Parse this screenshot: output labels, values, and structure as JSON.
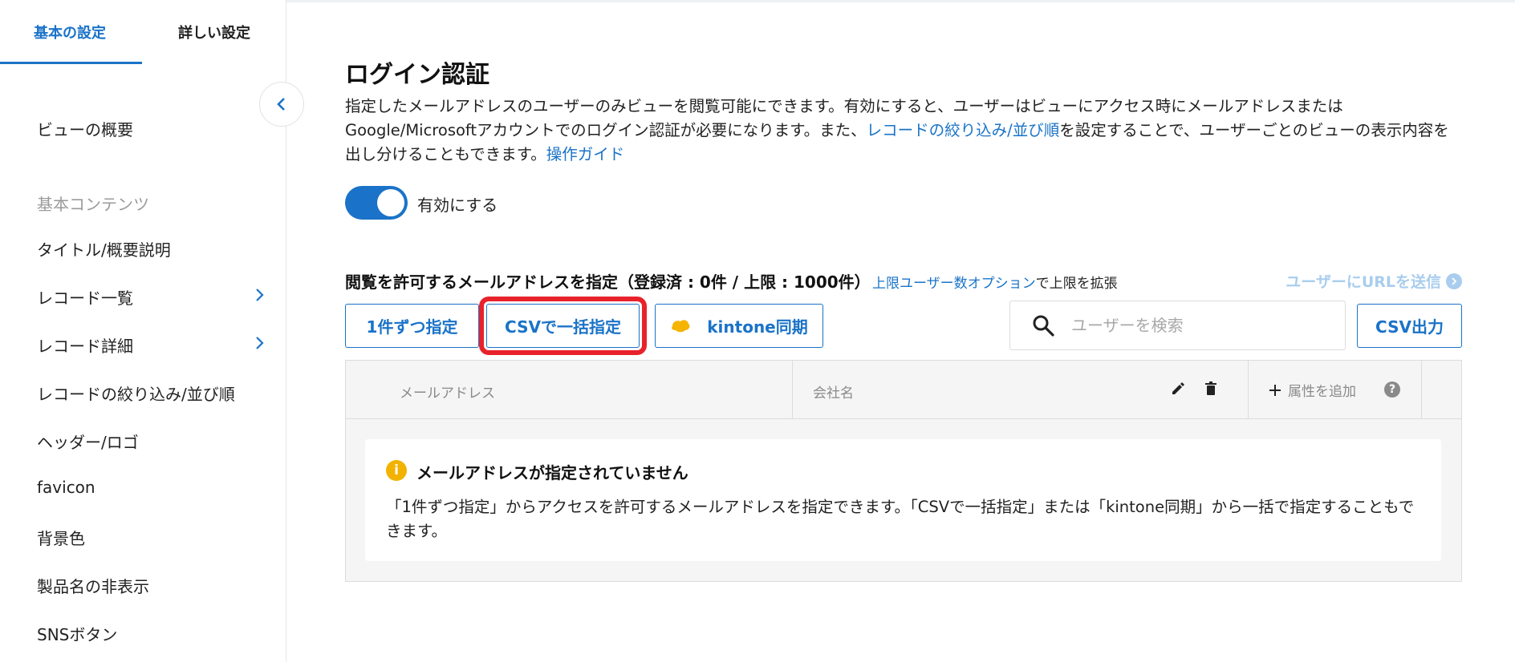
{
  "sidebar": {
    "tabs": [
      {
        "label": "基本の設定",
        "active": true
      },
      {
        "label": "詳しい設定",
        "active": false
      }
    ],
    "items": [
      {
        "label": "ビューの概要"
      },
      {
        "label": "基本コンテンツ"
      },
      {
        "label": "タイトル/概要説明"
      },
      {
        "label": "レコード一覧",
        "has_submenu": true
      },
      {
        "label": "レコード詳細",
        "has_submenu": true
      },
      {
        "label": "レコードの絞り込み/並び順"
      },
      {
        "label": "ヘッダー/ロゴ"
      },
      {
        "label": "favicon"
      },
      {
        "label": "背景色"
      },
      {
        "label": "製品名の非表示"
      },
      {
        "label": "SNSボタン"
      }
    ]
  },
  "main": {
    "title": "ログイン認証",
    "description": {
      "part1": "指定したメールアドレスのユーザーのみビューを閲覧可能にできます。有効にすると、ユーザーはビューにアクセス時にメールアドレスまたはGoogle/Microsoftアカウントでのログイン認証が必要になります。また、",
      "link1": "レコードの絞り込み/並び順",
      "part2": "を設定することで、ユーザーごとのビューの表示内容を出し分けることもできます。",
      "link2": "操作ガイド"
    },
    "toggle": {
      "label": "有効にする",
      "enabled": true
    },
    "allowed": {
      "heading": "閲覧を許可するメールアドレスを指定（登録済 : 0件 / 上限 : 1000件）",
      "limit_link": "上限ユーザー数オプション",
      "limit_suffix": "で上限を拡張",
      "send_url": "ユーザーにURLを送信"
    },
    "buttons": {
      "single": "1件ずつ指定",
      "csv": "CSVで一括指定",
      "kintone": "kintone同期",
      "export": "CSV出力"
    },
    "search": {
      "placeholder": "ユーザーを検索",
      "value": ""
    },
    "table": {
      "columns": [
        "メールアドレス",
        "会社名"
      ],
      "add_attribute": "属性を追加",
      "help": "?"
    },
    "empty": {
      "title": "メールアドレスが指定されていません",
      "message": "「1件ずつ指定」からアクセスを許可するメールアドレスを指定できます。「CSVで一括指定」または「kintone同期」から一括で指定することもできます。"
    }
  },
  "colors": {
    "accent": "#1a73c8",
    "highlight": "#e8222b",
    "info": "#f2b300",
    "muted": "#9a9a9a"
  },
  "icons": [
    "chevron-left-icon",
    "chevron-right-icon",
    "search-icon",
    "kintone-icon",
    "edit-icon",
    "trash-icon",
    "plus-icon",
    "help-icon",
    "info-icon",
    "arrow-right-circle-icon"
  ]
}
